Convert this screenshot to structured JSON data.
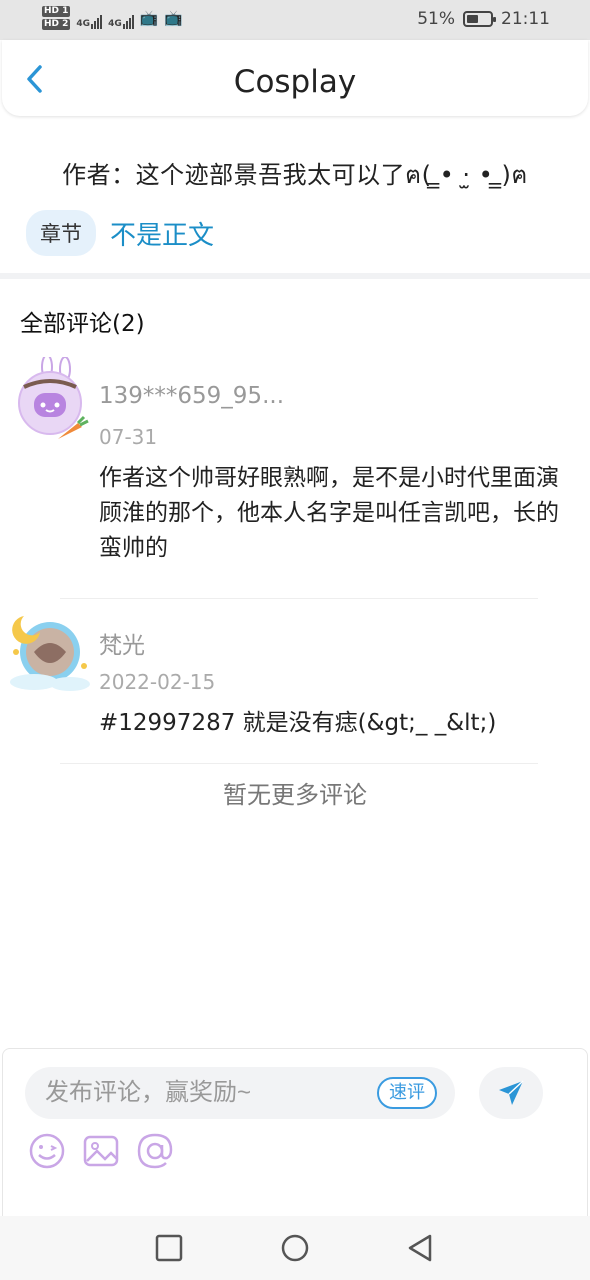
{
  "status_bar": {
    "hd1": "HD 1",
    "hd2": "HD 2",
    "net1": "4G",
    "net2": "4G",
    "battery_percent": "51%",
    "battery_level": 0.51,
    "time": "21:11"
  },
  "header": {
    "title": "Cosplay",
    "back_icon": "chevron-left-icon"
  },
  "author_line": "作者：这个迹部景吾我太可以了ฅ( ̳• ·̫ • ̳)ฅ",
  "chapter": {
    "tag": "章节",
    "link": "不是正文"
  },
  "comments_header": "全部评论(2)",
  "comments": [
    {
      "user": "139***659_95...",
      "date": "07-31",
      "text": "作者这个帅哥好眼熟啊，是不是小时代里面演顾淮的那个，他本人名字是叫任言凯吧，长的蛮帅的",
      "avatar": "bunny-chat-avatar"
    },
    {
      "user": "梵光",
      "date": "2022-02-15",
      "text": "#12997287 就是没有痣(&gt;_ _&lt;)",
      "avatar": "moon-frame-avatar"
    }
  ],
  "no_more": "暂无更多评论",
  "composer": {
    "placeholder": "发布评论，赢奖励~",
    "quick_label": "速评",
    "tools": [
      "emoji-icon",
      "image-icon",
      "at-icon"
    ]
  },
  "colors": {
    "accent": "#1b8ec7",
    "purple_tools": "#c9a6e6"
  }
}
